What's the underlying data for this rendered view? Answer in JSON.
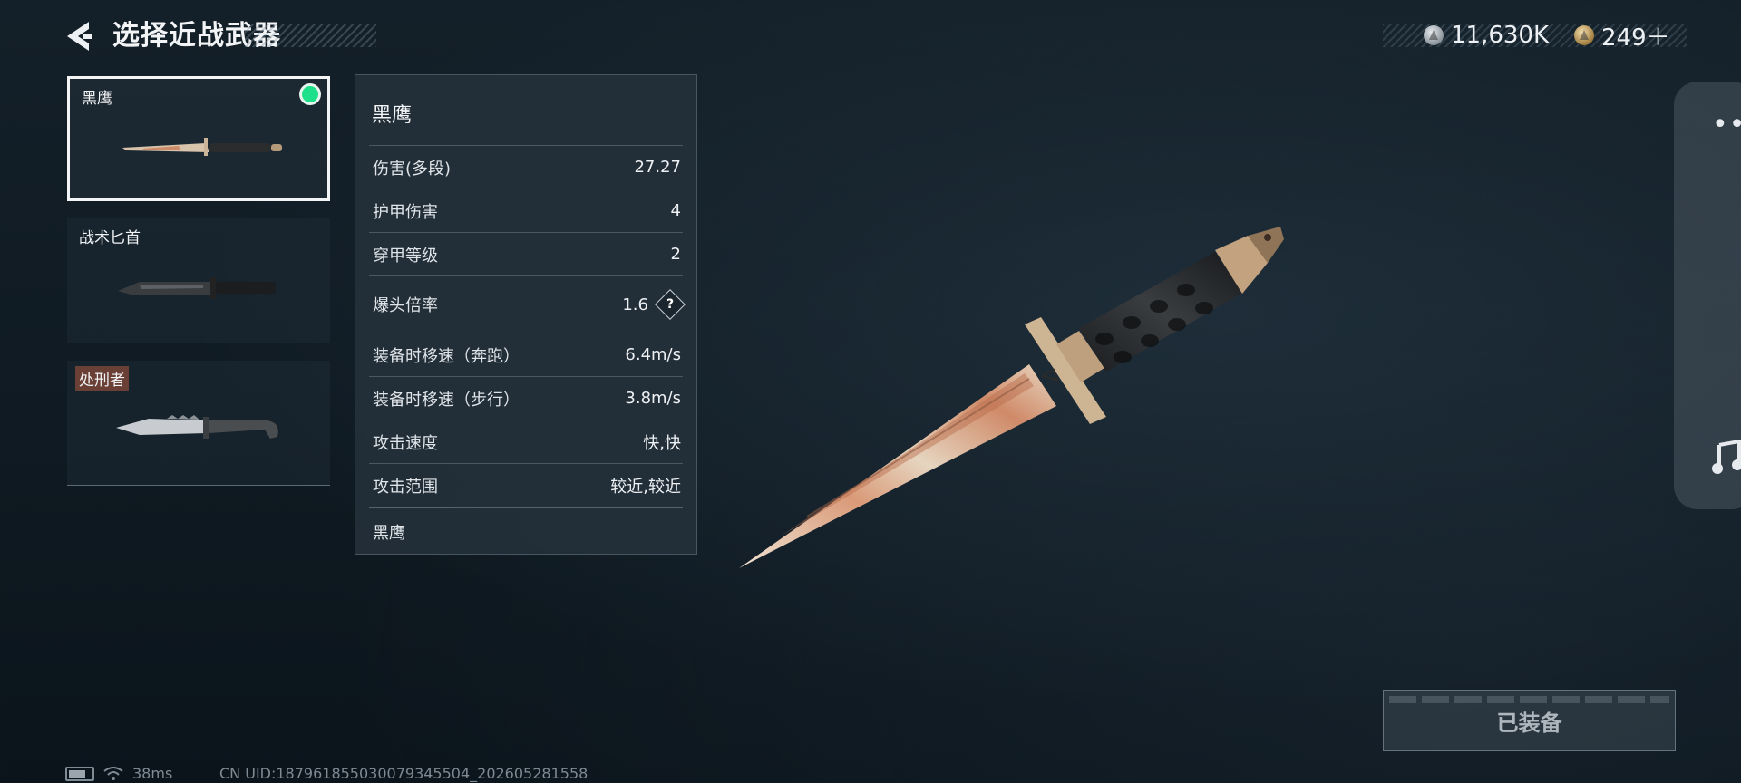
{
  "header": {
    "title": "选择近战武器"
  },
  "currency": {
    "silver": "11,630K",
    "gold": "249＋"
  },
  "weapons": [
    {
      "name": "黑鹰",
      "equipped": true,
      "selected": true
    },
    {
      "name": "战术匕首",
      "equipped": false,
      "selected": false
    },
    {
      "name": "处刑者",
      "equipped": false,
      "selected": false
    }
  ],
  "stats": {
    "title": "黑鹰",
    "rows": [
      {
        "label": "伤害(多段)",
        "value": "27.27"
      },
      {
        "label": "护甲伤害",
        "value": "4"
      },
      {
        "label": "穿甲等级",
        "value": "2"
      },
      {
        "label": "爆头倍率",
        "value": "1.6",
        "help": "?"
      },
      {
        "label": "装备时移速（奔跑）",
        "value": "6.4m/s"
      },
      {
        "label": "装备时移速（步行）",
        "value": "3.8m/s"
      },
      {
        "label": "攻击速度",
        "value": "快,快"
      },
      {
        "label": "攻击范围",
        "value": "较近,较近"
      }
    ],
    "footer": "黑鹰"
  },
  "drawer": {
    "dots": "••"
  },
  "equip_button": {
    "label": "已装备"
  },
  "status_bar": {
    "ping": "38ms",
    "uid": "CN UID:187961855030079345504_202605281558"
  },
  "colors": {
    "equipped_dot": "#1fe08a",
    "tag_bg": "#6a3f35",
    "panel_bg": "#24303a"
  },
  "icons": [
    "back-arrow-icon",
    "silver-coin-icon",
    "gold-coin-icon",
    "help-icon",
    "music-icon",
    "battery-icon",
    "wifi-icon",
    "more-dots-icon"
  ]
}
